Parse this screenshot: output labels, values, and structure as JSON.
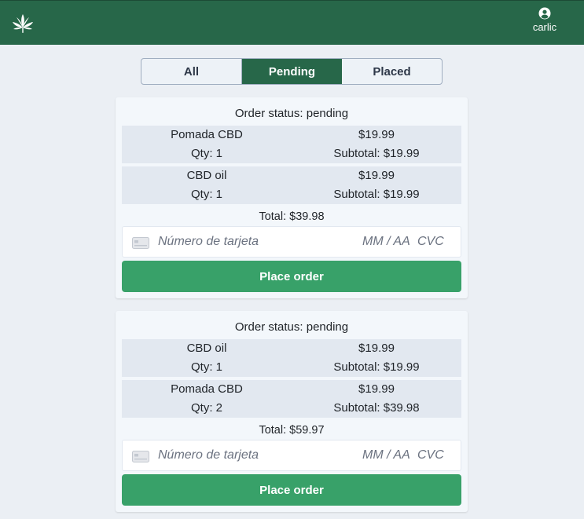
{
  "colors": {
    "header": "#276749",
    "tab_active": "#276749",
    "place_button": "#38a169",
    "item_row": "#e2e8f0",
    "page_bg": "#ebeff4"
  },
  "header": {
    "logo_icon": "cannabis-leaf-icon",
    "user_icon": "user-circle-icon",
    "username": "carlic"
  },
  "tabs": [
    {
      "label": "All",
      "active": false
    },
    {
      "label": "Pending",
      "active": true
    },
    {
      "label": "Placed",
      "active": false
    }
  ],
  "orders": [
    {
      "status": "Order status: pending",
      "items": [
        {
          "name": "Pomada CBD",
          "price": "$19.99",
          "qty": "Qty: 1",
          "subtotal": "Subtotal: $19.99"
        },
        {
          "name": "CBD oil",
          "price": "$19.99",
          "qty": "Qty: 1",
          "subtotal": "Subtotal: $19.99"
        }
      ],
      "total": "Total: $39.98",
      "card_placeholder": "Número de tarjeta",
      "exp_placeholder": "MM / AA",
      "cvc_placeholder": "CVC",
      "place_label": "Place order"
    },
    {
      "status": "Order status: pending",
      "items": [
        {
          "name": "CBD oil",
          "price": "$19.99",
          "qty": "Qty: 1",
          "subtotal": "Subtotal: $19.99"
        },
        {
          "name": "Pomada CBD",
          "price": "$19.99",
          "qty": "Qty: 2",
          "subtotal": "Subtotal: $39.98"
        }
      ],
      "total": "Total: $59.97",
      "card_placeholder": "Número de tarjeta",
      "exp_placeholder": "MM / AA",
      "cvc_placeholder": "CVC",
      "place_label": "Place order"
    }
  ]
}
